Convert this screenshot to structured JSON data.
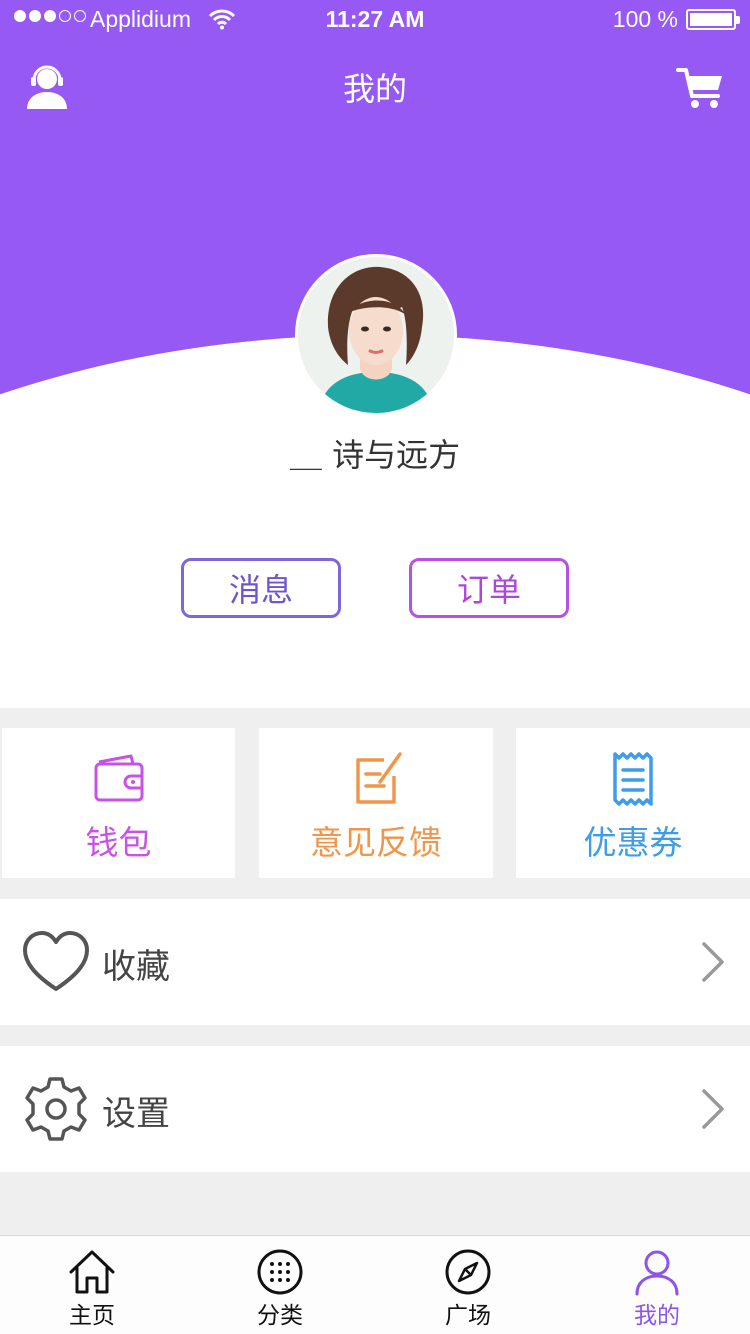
{
  "status_bar": {
    "carrier": "Applidium",
    "time": "11:27 AM",
    "battery": "100 %"
  },
  "nav": {
    "title": "我的",
    "left_icon": "customer-service-icon",
    "right_icon": "cart-icon"
  },
  "profile": {
    "username": "＿ 诗与远方",
    "avatar": "avatar-photo"
  },
  "actions": {
    "messages_label": "消息",
    "orders_label": "订单"
  },
  "cards": [
    {
      "label": "钱包",
      "icon": "wallet-icon",
      "color": "#c652e8"
    },
    {
      "label": "意见反馈",
      "icon": "feedback-edit-icon",
      "color": "#f0954a"
    },
    {
      "label": "优惠券",
      "icon": "coupon-icon",
      "color": "#3f9ce8"
    }
  ],
  "list": [
    {
      "label": "收藏",
      "icon": "heart-icon"
    },
    {
      "label": "设置",
      "icon": "gear-icon"
    }
  ],
  "tabbar": {
    "items": [
      {
        "label": "主页",
        "icon": "home-icon"
      },
      {
        "label": "分类",
        "icon": "grid-dots-icon"
      },
      {
        "label": "广场",
        "icon": "compass-icon"
      },
      {
        "label": "我的",
        "icon": "user-icon"
      }
    ],
    "active_color": "#8c54ee"
  },
  "colors": {
    "header_purple": "#9659f3",
    "background": "#efefef"
  }
}
